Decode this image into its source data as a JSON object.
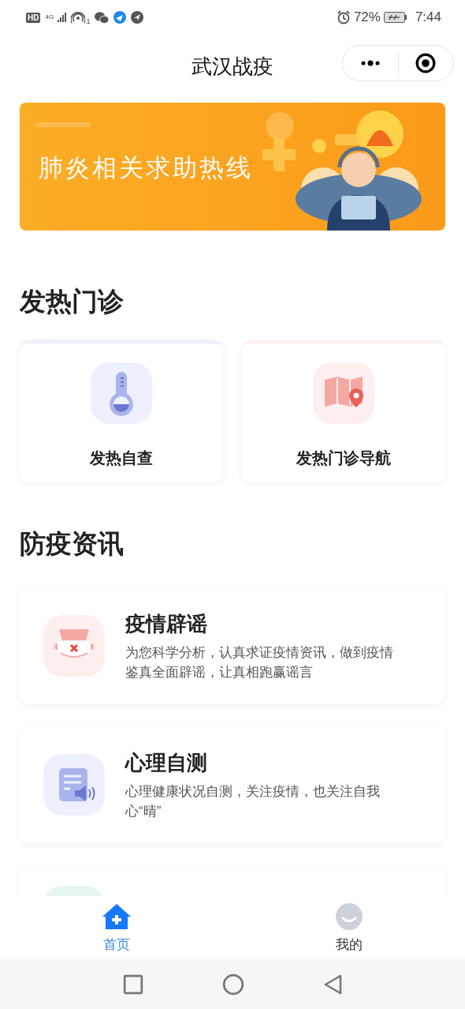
{
  "status_bar": {
    "hd": "HD",
    "network": "4G",
    "hotspot_count": "1",
    "battery": "72%",
    "time": "7:44"
  },
  "title_bar": {
    "title": "武汉战疫"
  },
  "banner": {
    "text": "肺炎相关求助热线"
  },
  "sections": [
    {
      "title": "发热门诊",
      "kind": "grid",
      "items": [
        {
          "title": "发热自查"
        },
        {
          "title": "发热门诊导航"
        }
      ]
    },
    {
      "title": "防疫资讯",
      "kind": "list",
      "items": [
        {
          "title": "疫情辟谣",
          "description": "为您科学分析，认真求证疫情资讯，做到疫情鉴真全面辟谣，让真相跑赢谣言"
        },
        {
          "title": "心理自测",
          "description": "心理健康状况自测，关注疫情，也关注自我心“晴”"
        },
        {
          "kind": "partial"
        }
      ]
    }
  ],
  "tab_bar": [
    {
      "label": "首页",
      "selected": true
    },
    {
      "label": "我的",
      "selected": false
    }
  ]
}
